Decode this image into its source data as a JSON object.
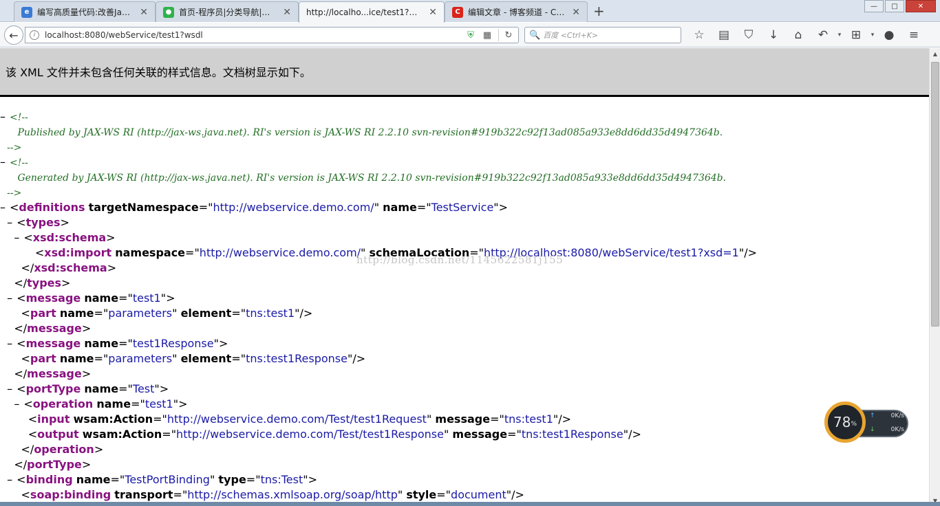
{
  "tabs": [
    {
      "title": "编写高质量代码:改善Java...",
      "favicon": "browser-icon",
      "color": "#3a7bd5",
      "active": false
    },
    {
      "title": "首页-程序员|分类导航|网...",
      "favicon": "wechat-icon",
      "color": "#2eb34a",
      "active": false
    },
    {
      "title": "http://localho...ice/test1?wsdl",
      "favicon": "",
      "color": "",
      "active": true
    },
    {
      "title": "编辑文章 - 博客频道 - CS...",
      "favicon": "csdn-icon",
      "color": "#d9251c",
      "active": false
    }
  ],
  "new_tab_label": "+",
  "window_controls": {
    "minimize": "—",
    "maximize": "□",
    "close": "✕"
  },
  "nav": {
    "url": "localhost:8080/webService/test1?wsdl",
    "search_placeholder": "百度 <Ctrl+K>"
  },
  "icons": {
    "back": "←",
    "info": "i",
    "shield": "⛨",
    "qr": "▦",
    "reload": "↻",
    "search": "🔍",
    "bookmark": "☆",
    "reader": "▤",
    "pocket": "⛉",
    "download": "↓",
    "home": "⌂",
    "undo": "↶",
    "crop": "⊞",
    "chat": "●",
    "menu": "≡",
    "dropdown": "▾",
    "toggle": "–"
  },
  "xml_notice": "该 XML 文件并未包含任何关联的样式信息。文档树显示如下。",
  "xml": {
    "comment_open": "<!--",
    "comment_close": "-->",
    "published": "Published by JAX-WS RI (http://jax-ws.java.net). RI's version is JAX-WS RI 2.2.10 svn-revision#919b322c92f13ad085a933e8dd6dd35d4947364b.",
    "generated": "Generated by JAX-WS RI (http://jax-ws.java.net). RI's version is JAX-WS RI 2.2.10 svn-revision#919b322c92f13ad085a933e8dd6dd35d4947364b.",
    "definitions": {
      "tag": "definitions",
      "a1": "targetNamespace",
      "v1": "http://webservice.demo.com/",
      "a2": "name",
      "v2": "TestService"
    },
    "types": "types",
    "schema": "xsd:schema",
    "import": {
      "tag": "xsd:import",
      "a1": "namespace",
      "v1": "http://webservice.demo.com/",
      "a2": "schemaLocation",
      "v2": "http://localhost:8080/webService/test1?xsd=1"
    },
    "message1": {
      "tag": "message",
      "a1": "name",
      "v1": "test1"
    },
    "part1": {
      "tag": "part",
      "a1": "name",
      "v1": "parameters",
      "a2": "element",
      "v2": "tns:test1"
    },
    "message2": {
      "tag": "message",
      "a1": "name",
      "v1": "test1Response"
    },
    "part2": {
      "tag": "part",
      "a1": "name",
      "v1": "parameters",
      "a2": "element",
      "v2": "tns:test1Response"
    },
    "portType": {
      "tag": "portType",
      "a1": "name",
      "v1": "Test"
    },
    "operation": {
      "tag": "operation",
      "a1": "name",
      "v1": "test1"
    },
    "input": {
      "tag": "input",
      "a1": "wsam:Action",
      "v1": "http://webservice.demo.com/Test/test1Request",
      "a2": "message",
      "v2": "tns:test1"
    },
    "output": {
      "tag": "output",
      "a1": "wsam:Action",
      "v1": "http://webservice.demo.com/Test/test1Response",
      "a2": "message",
      "v2": "tns:test1Response"
    },
    "binding": {
      "tag": "binding",
      "a1": "name",
      "v1": "TestPortBinding",
      "a2": "type",
      "v2": "tns:Test"
    },
    "soapBinding": {
      "tag": "soap:binding",
      "a1": "transport",
      "v1": "http://schemas.xmlsoap.org/soap/http",
      "a2": "style",
      "v2": "document"
    }
  },
  "watermark": "http://blog.csdn.net/1145622581j155",
  "speed_widget": {
    "percent": "78",
    "unit": "%",
    "upload": "0",
    "download": "0",
    "rate_unit": "K/s"
  }
}
